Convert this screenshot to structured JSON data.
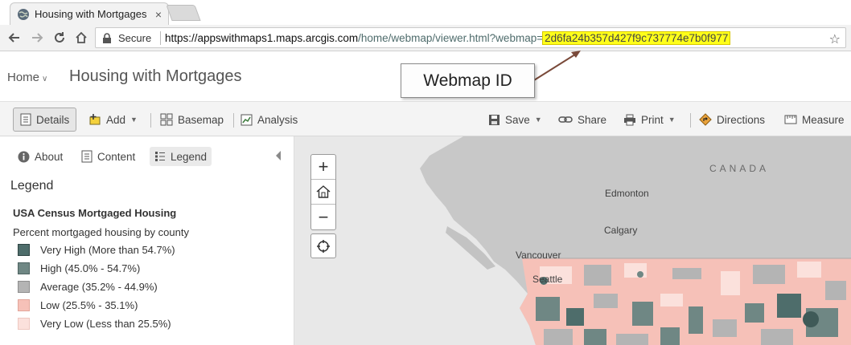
{
  "browser": {
    "tab_title": "Housing with Mortgages",
    "tab_close": "×",
    "secure_label": "Secure",
    "url_host": "https://appswithmaps1.maps.arcgis.com",
    "url_path": "/home/webmap/viewer.html?webmap=",
    "url_webmap_id": "2d6fa24b357d427f9c737774e7b0f977"
  },
  "callout": {
    "label": "Webmap ID"
  },
  "header": {
    "home_label": "Home",
    "title": "Housing with Mortgages"
  },
  "toolbar": {
    "details": "Details",
    "add": "Add",
    "basemap": "Basemap",
    "analysis": "Analysis",
    "save": "Save",
    "share": "Share",
    "print": "Print",
    "directions": "Directions",
    "measure": "Measure"
  },
  "panel": {
    "tabs": {
      "about": "About",
      "content": "Content",
      "legend": "Legend"
    },
    "legend_heading": "Legend",
    "layer_title": "USA Census Mortgaged Housing",
    "field_title": "Percent mortgaged housing by county",
    "legend_items": [
      {
        "label": "Very High (More than 54.7%)",
        "fill": "#4e6d6b",
        "stroke": "#2f4544"
      },
      {
        "label": "High (45.0% - 54.7%)",
        "fill": "#6f8784",
        "stroke": "#4e6361"
      },
      {
        "label": "Average (35.2% - 44.9%)",
        "fill": "#b4b4b4",
        "stroke": "#8e8e8e"
      },
      {
        "label": "Low (25.5% - 35.1%)",
        "fill": "#f6c1b8",
        "stroke": "#e2a69b"
      },
      {
        "label": "Very Low (Less than 25.5%)",
        "fill": "#fbe1dc",
        "stroke": "#eec8c1"
      }
    ]
  },
  "map": {
    "zoom_in": "+",
    "zoom_out": "−",
    "labels": {
      "canada": "CANADA",
      "edmonton": "Edmonton",
      "calgary": "Calgary",
      "vancouver": "Vancouver",
      "seattle": "Seattle"
    }
  },
  "colors": {
    "highlight": "#ffff1a",
    "callout_arrow": "#7a4a3a",
    "map_land": "#c8c8c8",
    "map_water": "#e8e8e8"
  }
}
